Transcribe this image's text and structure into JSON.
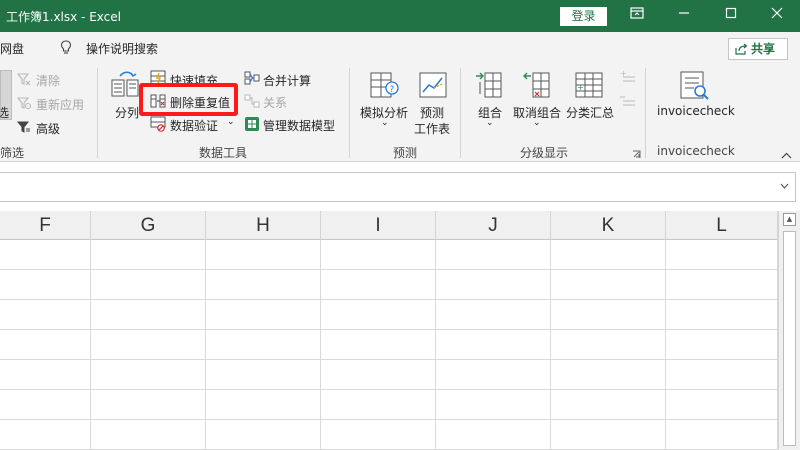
{
  "titlebar": {
    "title": "工作簿1.xlsx  -  Excel",
    "login_label": "登录",
    "ribbon_display_icon": "ribbon-display-options-icon",
    "minimize_icon": "minimize-icon",
    "maximize_icon": "maximize-icon",
    "close_icon": "close-icon"
  },
  "menu": {
    "tab_wangpan": "网盘",
    "search_label": "操作说明搜索",
    "share_label": "共享"
  },
  "ribbon": {
    "sort_filter": {
      "clear": "清除",
      "reapply": "重新应用",
      "advanced": "高级",
      "filter_partial": "选",
      "label": "筛选"
    },
    "data_tools": {
      "text_to_columns": "分列",
      "flash_fill": "快速填充",
      "remove_duplicates": "删除重复值",
      "data_validation": "数据验证",
      "consolidate": "合并计算",
      "relationships": "关系",
      "manage_data_model": "管理数据模型",
      "label": "数据工具"
    },
    "forecast": {
      "what_if": "模拟分析",
      "forecast_sheet_line1": "预测",
      "forecast_sheet_line2": "工作表",
      "label": "预测"
    },
    "outline": {
      "group": "组合",
      "ungroup": "取消组合",
      "subtotal": "分类汇总",
      "label": "分级显示"
    },
    "addin": {
      "button": "invoicecheck",
      "label": "invoicecheck"
    }
  },
  "grid": {
    "columns": [
      "F",
      "G",
      "H",
      "I",
      "J",
      "K",
      "L"
    ]
  },
  "colors": {
    "brand": "#217346",
    "highlight": "#ff1a1a"
  }
}
